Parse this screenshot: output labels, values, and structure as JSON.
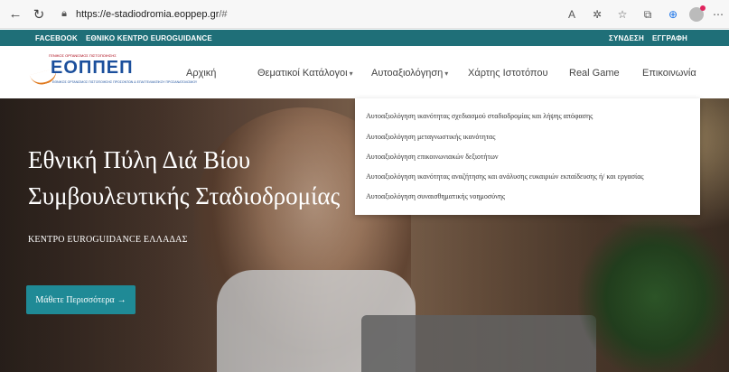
{
  "browser": {
    "url_host": "https://e-stadiodromia.eoppep.gr",
    "url_path": "/#",
    "icons": [
      "back-icon",
      "reload-icon",
      "lock-icon",
      "read-aloud-icon",
      "extensions-icon",
      "favorites-icon",
      "collections-icon",
      "downloads-icon",
      "profile-icon"
    ]
  },
  "topbar": {
    "left_links": [
      "FACEBOOK",
      "ΕΘΝΙΚΟ ΚΕΝΤΡΟ EUROGUIDANCE"
    ],
    "right_links": [
      "ΣΥΝΔΕΣΗ",
      "ΕΓΓΡΑΦΗ"
    ],
    "bg_color": "#1f6f78"
  },
  "logo": {
    "mark": "ΕΟΠΠΕΠ",
    "tiny_text": "ΓΕΝΙΚΟΣ ΟΡΓΑΝΙΣΜΟΣ ΠΙΣΤΟΠΟΙΗΣΗΣ",
    "sub_text": "ΕΘΝΙΚΟΣ ΟΡΓΑΝΙΣΜΟΣ ΠΙΣΤΟΠΟΙΗΣΗΣ ΠΡΟΣΟΝΤΩΝ & ΕΠΑΓΓΕΛΜΑΤΙΚΟΥ ΠΡΟΣΑΝΑΤΟΛΙΣΜΟΥ"
  },
  "nav": {
    "items": [
      {
        "label": "Αρχική",
        "has_caret": false
      },
      {
        "label": "Θεματικοί Κατάλογοι",
        "has_caret": true
      },
      {
        "label": "Αυτοαξιολόγηση",
        "has_caret": true
      },
      {
        "label": "Χάρτης Ιστοτόπου",
        "has_caret": false
      },
      {
        "label": "Real Game",
        "has_caret": false
      },
      {
        "label": "Επικοινωνία",
        "has_caret": false
      }
    ],
    "caret": "▾"
  },
  "hero": {
    "title_line1": "Εθνική Πύλη Διά Βίου",
    "title_line2": "Συμβουλευτικής Σταδιοδρομίας",
    "subtitle": "ΚΕΝΤΡΟ EUROGUIDANCE ΕΛΛΑΔΑΣ",
    "cta_label": "Μάθετε Περισσότερα",
    "cta_arrow": "→",
    "cta_color": "#1f8a96"
  },
  "dropdown": {
    "items": [
      "Αυτοαξιολόγηση ικανότητας σχεδιασμού σταδιοδρομίας και λήψης απόφασης",
      "Αυτοαξιολόγηση μεταγνωστικής ικανότητας",
      "Αυτοαξιολόγηση επικοινωνιακών δεξιοτήτων",
      "Αυτοαξιολόγηση ικανότητας αναζήτησης και ανάλυσης ευκαιριών εκπαίδευσης ή/ και εργασίας",
      "Αυτοαξιολόγηση συναισθηματικής νοημοσύνης"
    ]
  }
}
